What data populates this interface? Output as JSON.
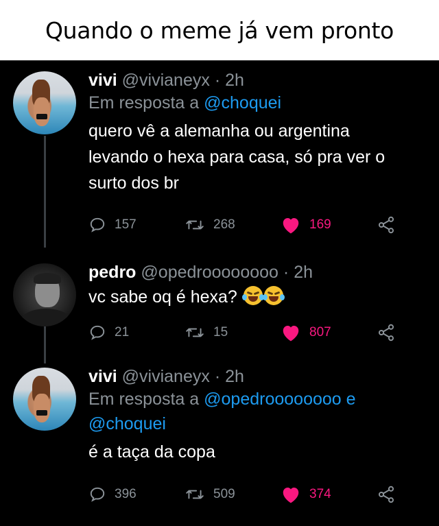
{
  "caption": "Quando o meme já vem pronto",
  "colors": {
    "background": "#000000",
    "muted": "#8b9298",
    "link": "#1d9bf0",
    "like": "#f91880",
    "thread_line": "#3a3f44"
  },
  "tweets": [
    {
      "name": "vivi",
      "handle": "@vivianeyx",
      "time": "· 2h",
      "reply_prefix": "Em resposta a",
      "reply_mention_1": "@choquei",
      "body_lines": [
        "quero vê a alemanha ou argentina",
        "levando o hexa para casa, só pra ver o",
        "surto dos br"
      ],
      "replies": "157",
      "retweets": "268",
      "likes": "169",
      "avatar_icon": "woman-pool-avatar"
    },
    {
      "name": "pedro",
      "handle": "@opedroooooooo",
      "time": "· 2h",
      "body": "vc sabe oq é hexa?",
      "emoji": "rolling-on-floor-laughing x2",
      "replies": "21",
      "retweets": "15",
      "likes": "807",
      "avatar_icon": "man-avatar"
    },
    {
      "name": "vivi",
      "handle": "@vivianeyx",
      "time": "· 2h",
      "reply_prefix": "Em resposta a",
      "reply_mention_1": "@opedroooooooo",
      "reply_joiner": "e",
      "reply_mention_2": "@choquei",
      "body": "é a taça da copa",
      "replies": "396",
      "retweets": "509",
      "likes": "374",
      "avatar_icon": "woman-pool-avatar"
    }
  ]
}
